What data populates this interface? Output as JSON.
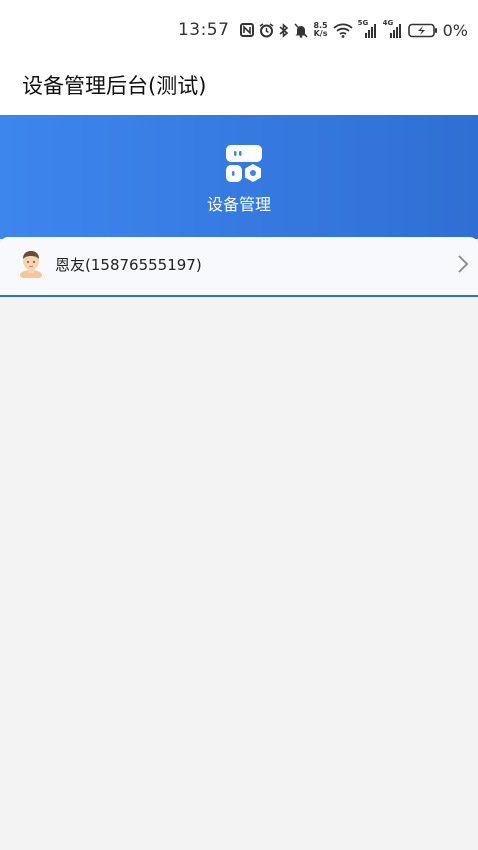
{
  "status_bar": {
    "time": "13:57",
    "net_speed_value": "8.5",
    "net_speed_unit": "K/s",
    "signal_1_label": "5G",
    "signal_2_label": "4G",
    "battery_percent": "0%"
  },
  "app_bar": {
    "title": "设备管理后台(测试)"
  },
  "banner": {
    "label": "设备管理",
    "icon": "device-management-icon",
    "color_left": "#3d86ee",
    "color_right": "#2f6fd4"
  },
  "user": {
    "label": "恩友(15876555197)",
    "avatar": "user-avatar",
    "chevron": "chevron-right-icon"
  }
}
